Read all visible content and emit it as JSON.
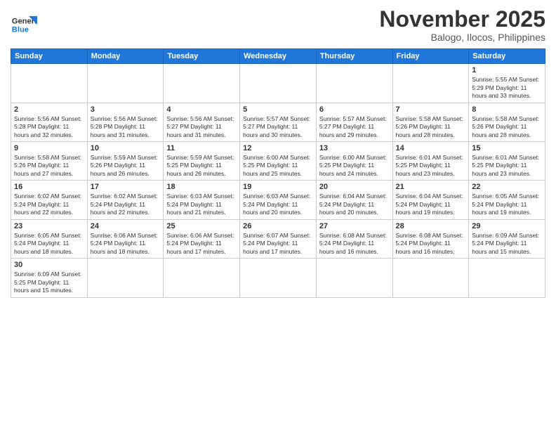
{
  "header": {
    "logo_general": "General",
    "logo_blue": "Blue",
    "month": "November 2025",
    "location": "Balogo, Ilocos, Philippines"
  },
  "weekdays": [
    "Sunday",
    "Monday",
    "Tuesday",
    "Wednesday",
    "Thursday",
    "Friday",
    "Saturday"
  ],
  "weeks": [
    [
      {
        "day": "",
        "info": ""
      },
      {
        "day": "",
        "info": ""
      },
      {
        "day": "",
        "info": ""
      },
      {
        "day": "",
        "info": ""
      },
      {
        "day": "",
        "info": ""
      },
      {
        "day": "",
        "info": ""
      },
      {
        "day": "1",
        "info": "Sunrise: 5:55 AM\nSunset: 5:29 PM\nDaylight: 11 hours\nand 33 minutes."
      }
    ],
    [
      {
        "day": "2",
        "info": "Sunrise: 5:56 AM\nSunset: 5:28 PM\nDaylight: 11 hours\nand 32 minutes."
      },
      {
        "day": "3",
        "info": "Sunrise: 5:56 AM\nSunset: 5:28 PM\nDaylight: 11 hours\nand 31 minutes."
      },
      {
        "day": "4",
        "info": "Sunrise: 5:56 AM\nSunset: 5:27 PM\nDaylight: 11 hours\nand 31 minutes."
      },
      {
        "day": "5",
        "info": "Sunrise: 5:57 AM\nSunset: 5:27 PM\nDaylight: 11 hours\nand 30 minutes."
      },
      {
        "day": "6",
        "info": "Sunrise: 5:57 AM\nSunset: 5:27 PM\nDaylight: 11 hours\nand 29 minutes."
      },
      {
        "day": "7",
        "info": "Sunrise: 5:58 AM\nSunset: 5:26 PM\nDaylight: 11 hours\nand 28 minutes."
      },
      {
        "day": "8",
        "info": "Sunrise: 5:58 AM\nSunset: 5:26 PM\nDaylight: 11 hours\nand 28 minutes."
      }
    ],
    [
      {
        "day": "9",
        "info": "Sunrise: 5:58 AM\nSunset: 5:26 PM\nDaylight: 11 hours\nand 27 minutes."
      },
      {
        "day": "10",
        "info": "Sunrise: 5:59 AM\nSunset: 5:26 PM\nDaylight: 11 hours\nand 26 minutes."
      },
      {
        "day": "11",
        "info": "Sunrise: 5:59 AM\nSunset: 5:25 PM\nDaylight: 11 hours\nand 26 minutes."
      },
      {
        "day": "12",
        "info": "Sunrise: 6:00 AM\nSunset: 5:25 PM\nDaylight: 11 hours\nand 25 minutes."
      },
      {
        "day": "13",
        "info": "Sunrise: 6:00 AM\nSunset: 5:25 PM\nDaylight: 11 hours\nand 24 minutes."
      },
      {
        "day": "14",
        "info": "Sunrise: 6:01 AM\nSunset: 5:25 PM\nDaylight: 11 hours\nand 23 minutes."
      },
      {
        "day": "15",
        "info": "Sunrise: 6:01 AM\nSunset: 5:25 PM\nDaylight: 11 hours\nand 23 minutes."
      }
    ],
    [
      {
        "day": "16",
        "info": "Sunrise: 6:02 AM\nSunset: 5:24 PM\nDaylight: 11 hours\nand 22 minutes."
      },
      {
        "day": "17",
        "info": "Sunrise: 6:02 AM\nSunset: 5:24 PM\nDaylight: 11 hours\nand 22 minutes."
      },
      {
        "day": "18",
        "info": "Sunrise: 6:03 AM\nSunset: 5:24 PM\nDaylight: 11 hours\nand 21 minutes."
      },
      {
        "day": "19",
        "info": "Sunrise: 6:03 AM\nSunset: 5:24 PM\nDaylight: 11 hours\nand 20 minutes."
      },
      {
        "day": "20",
        "info": "Sunrise: 6:04 AM\nSunset: 5:24 PM\nDaylight: 11 hours\nand 20 minutes."
      },
      {
        "day": "21",
        "info": "Sunrise: 6:04 AM\nSunset: 5:24 PM\nDaylight: 11 hours\nand 19 minutes."
      },
      {
        "day": "22",
        "info": "Sunrise: 6:05 AM\nSunset: 5:24 PM\nDaylight: 11 hours\nand 19 minutes."
      }
    ],
    [
      {
        "day": "23",
        "info": "Sunrise: 6:05 AM\nSunset: 5:24 PM\nDaylight: 11 hours\nand 18 minutes."
      },
      {
        "day": "24",
        "info": "Sunrise: 6:06 AM\nSunset: 5:24 PM\nDaylight: 11 hours\nand 18 minutes."
      },
      {
        "day": "25",
        "info": "Sunrise: 6:06 AM\nSunset: 5:24 PM\nDaylight: 11 hours\nand 17 minutes."
      },
      {
        "day": "26",
        "info": "Sunrise: 6:07 AM\nSunset: 5:24 PM\nDaylight: 11 hours\nand 17 minutes."
      },
      {
        "day": "27",
        "info": "Sunrise: 6:08 AM\nSunset: 5:24 PM\nDaylight: 11 hours\nand 16 minutes."
      },
      {
        "day": "28",
        "info": "Sunrise: 6:08 AM\nSunset: 5:24 PM\nDaylight: 11 hours\nand 16 minutes."
      },
      {
        "day": "29",
        "info": "Sunrise: 6:09 AM\nSunset: 5:24 PM\nDaylight: 11 hours\nand 15 minutes."
      }
    ],
    [
      {
        "day": "30",
        "info": "Sunrise: 6:09 AM\nSunset: 5:25 PM\nDaylight: 11 hours\nand 15 minutes."
      },
      {
        "day": "",
        "info": ""
      },
      {
        "day": "",
        "info": ""
      },
      {
        "day": "",
        "info": ""
      },
      {
        "day": "",
        "info": ""
      },
      {
        "day": "",
        "info": ""
      },
      {
        "day": "",
        "info": ""
      }
    ]
  ]
}
